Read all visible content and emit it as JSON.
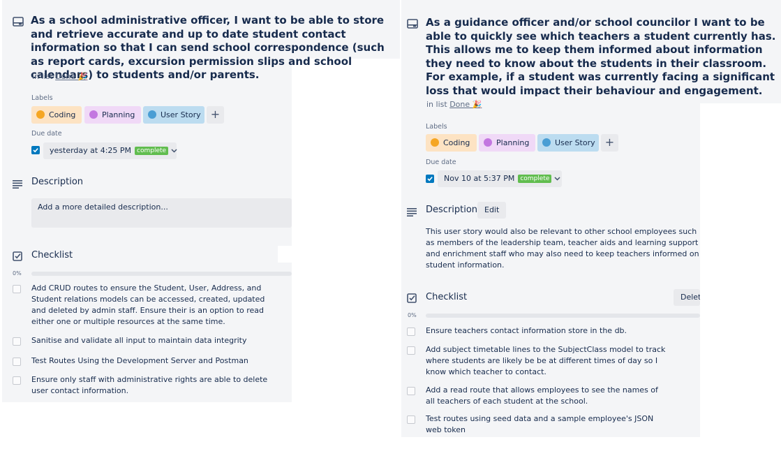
{
  "left": {
    "title": "As a school administrative officer, I want to be able to store and retrieve accurate and up to date student contact information so that I can send school correspondence (such as report cards, excursion permission slips and school calendars) to students and/or parents.",
    "in_list_prefix": "in list",
    "list_name": "Done 🎉",
    "labels_heading": "Labels",
    "labels": [
      {
        "name": "Coding",
        "dot": "#f5a623",
        "bg": "#fde3c3"
      },
      {
        "name": "Planning",
        "dot": "#c377e0",
        "bg": "#f0d9f7"
      },
      {
        "name": "User Story",
        "dot": "#4a9ed4",
        "bg": "#bcdcf0"
      }
    ],
    "add_label": "+",
    "due_heading": "Due date",
    "due_text": "yesterday at 4:25 PM",
    "due_badge": "complete",
    "description_heading": "Description",
    "description_placeholder": "Add a more detailed description...",
    "checklist_heading": "Checklist",
    "progress": "0%",
    "progress_value": 0,
    "items": [
      "Add CRUD routes to ensure the Student, User, Address, and Student relations models can be accessed, created, updated and deleted by admin staff. Ensure their is an option to read either one or multiple resources at the same time.",
      "Sanitise and validate all input to maintain data integrity",
      "Test Routes Using the Development Server and Postman",
      "Ensure only staff with administrative rights are able to delete user contact information."
    ]
  },
  "right": {
    "title": "As a guidance officer and/or school councilor I want to be able to quickly see which teachers a student currently has. This allows me to keep them informed about information they need to know about the students in their classroom. For example, if a student was currently facing a significant loss that would impact their behaviour and engagement.",
    "in_list_prefix": "in list",
    "list_name": "Done 🎉",
    "labels_heading": "Labels",
    "labels": [
      {
        "name": "Coding",
        "dot": "#f5a623",
        "bg": "#fde3c3"
      },
      {
        "name": "Planning",
        "dot": "#c377e0",
        "bg": "#f0d9f7"
      },
      {
        "name": "User Story",
        "dot": "#4a9ed4",
        "bg": "#bcdcf0"
      }
    ],
    "add_label": "+",
    "due_heading": "Due date",
    "due_text": "Nov 10 at 5:37 PM",
    "due_badge": "complete",
    "description_heading": "Description",
    "edit_label": "Edit",
    "description_text": "This user story would also be relevant to other school employees such as members of the leadership team, teacher aids and learning support and enrichment staff who may also need to keep teachers informed on student information.",
    "checklist_heading": "Checklist",
    "delete_label": "Delete",
    "progress": "0%",
    "progress_value": 0,
    "items": [
      "Ensure teachers contact information store in the db.",
      "Add subject timetable lines to the SubjectClass model to track where students are likely be be at different times of day so I know which teacher to contact.",
      "Add a read route that allows employees to see the names of all teachers of each student at the school.",
      "Test routes using seed data and a sample employee's JSON web token"
    ]
  }
}
